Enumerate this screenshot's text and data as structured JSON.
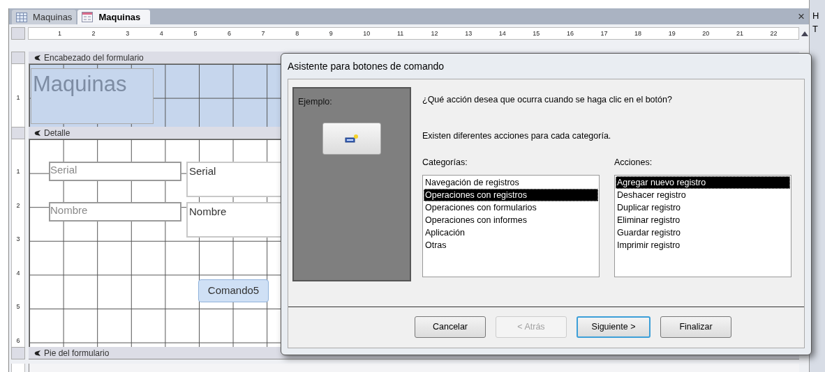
{
  "document_tabs": [
    {
      "label": "Maquinas",
      "kind": "table",
      "selected": false
    },
    {
      "label": "Maquinas",
      "kind": "form",
      "selected": true
    }
  ],
  "close_symbol": "×",
  "ruler": {
    "numbers": [
      "1",
      "2",
      "3",
      "4",
      "5",
      "6",
      "7",
      "8",
      "9",
      "10",
      "11",
      "12",
      "13",
      "14",
      "15",
      "16",
      "17",
      "18",
      "19",
      "20",
      "21",
      "22"
    ]
  },
  "sections": [
    {
      "title": "Encabezado del formulario",
      "kind": "header",
      "ruler_numbers": [
        "1"
      ],
      "controls": [
        {
          "kind": "title",
          "text": "Maquinas"
        }
      ]
    },
    {
      "title": "Detalle",
      "kind": "detail",
      "ruler_numbers": [
        "1",
        "2",
        "3",
        "4",
        "5",
        "6"
      ],
      "controls": [
        {
          "kind": "label",
          "text": "Serial"
        },
        {
          "kind": "textbox",
          "text": "Serial"
        },
        {
          "kind": "label",
          "text": "Nombre"
        },
        {
          "kind": "textbox",
          "text": "Nombre"
        },
        {
          "kind": "button",
          "text": "Comando5"
        }
      ]
    },
    {
      "title": "Pie del formulario",
      "kind": "footer"
    }
  ],
  "property_sheet": {
    "title_fragment": "H",
    "tab_fragment": "T"
  },
  "dialog": {
    "title": "Asistente para botones de comando",
    "example_label": "Ejemplo:",
    "question": "¿Qué acción desea que ocurra cuando se haga clic en el botón?",
    "hint": "Existen diferentes acciones para cada categoría.",
    "lists": [
      {
        "label": "Categorías:",
        "items": [
          {
            "label": "Navegación de registros",
            "selected": false
          },
          {
            "label": "Operaciones con registros",
            "selected": true
          },
          {
            "label": "Operaciones con formularios",
            "selected": false
          },
          {
            "label": "Operaciones con informes",
            "selected": false
          },
          {
            "label": "Aplicación",
            "selected": false
          },
          {
            "label": "Otras",
            "selected": false
          }
        ]
      },
      {
        "label": "Acciones:",
        "items": [
          {
            "label": "Agregar nuevo registro",
            "selected": true
          },
          {
            "label": "Deshacer registro",
            "selected": false
          },
          {
            "label": "Duplicar registro",
            "selected": false
          },
          {
            "label": "Eliminar registro",
            "selected": false
          },
          {
            "label": "Guardar registro",
            "selected": false
          },
          {
            "label": "Imprimir registro",
            "selected": false
          }
        ]
      }
    ],
    "buttons": [
      {
        "label": "Cancelar",
        "disabled": false,
        "default": false
      },
      {
        "label": "< Atrás",
        "disabled": true,
        "default": false
      },
      {
        "label": "Siguiente >",
        "disabled": false,
        "default": true
      },
      {
        "label": "Finalizar",
        "disabled": false,
        "default": false
      }
    ]
  }
}
